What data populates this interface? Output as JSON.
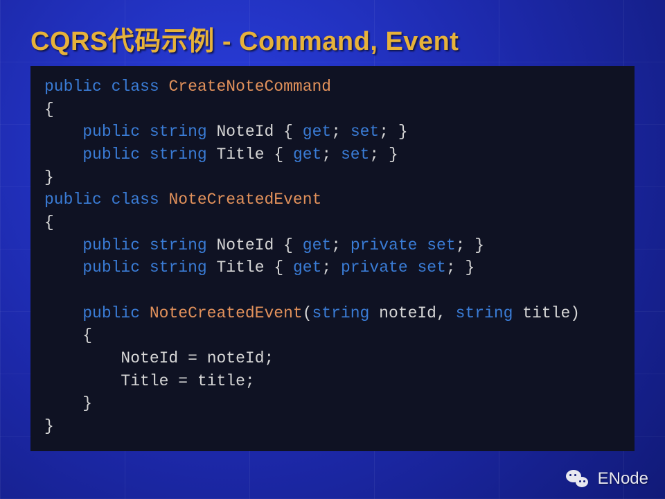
{
  "title": "CQRS代码示例 - Command, Event",
  "code": {
    "l1": {
      "kw1": "public",
      "kw2": "class",
      "type": "CreateNoteCommand"
    },
    "l2": "{",
    "l3": {
      "kw1": "public",
      "kw2": "string",
      "name": "NoteId",
      "get": "get",
      "set": "set"
    },
    "l4": {
      "kw1": "public",
      "kw2": "string",
      "name": "Title",
      "get": "get",
      "set": "set"
    },
    "l5": "}",
    "l6": {
      "kw1": "public",
      "kw2": "class",
      "type": "NoteCreatedEvent"
    },
    "l7": "{",
    "l8": {
      "kw1": "public",
      "kw2": "string",
      "name": "NoteId",
      "get": "get",
      "priv": "private",
      "set": "set"
    },
    "l9": {
      "kw1": "public",
      "kw2": "string",
      "name": "Title",
      "get": "get",
      "priv": "private",
      "set": "set"
    },
    "l10": {
      "kw1": "public",
      "ctor": "NoteCreatedEvent",
      "kw2": "string",
      "p1": "noteId",
      "kw3": "string",
      "p2": "title"
    },
    "l11": "    {",
    "l12": {
      "lhs": "NoteId",
      "rhs": "noteId"
    },
    "l13": {
      "lhs": "Title",
      "rhs": "title"
    },
    "l14": "    }",
    "l15": "}"
  },
  "footer": {
    "label": "ENode"
  }
}
